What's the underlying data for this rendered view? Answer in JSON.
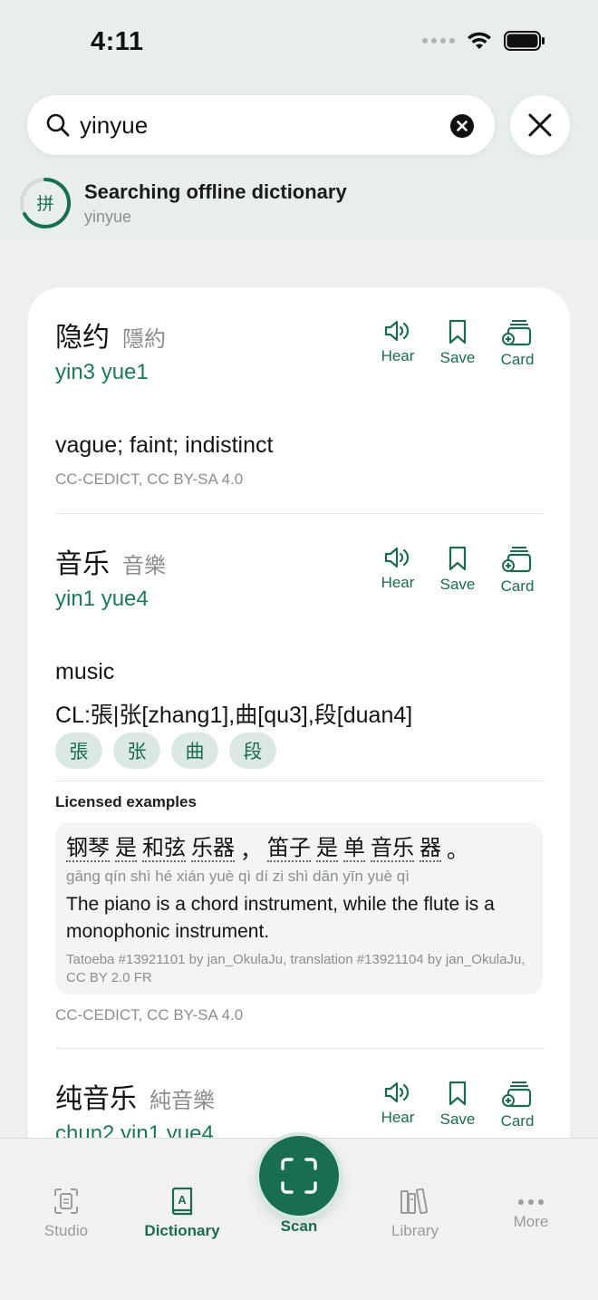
{
  "status_bar": {
    "time": "4:11"
  },
  "search": {
    "value": "yinyue"
  },
  "search_status": {
    "badge": "拼",
    "title": "Searching offline dictionary",
    "query": "yinyue"
  },
  "actions": {
    "hear": "Hear",
    "save": "Save",
    "card": "Card"
  },
  "entries": [
    {
      "simplified": "隐约",
      "traditional": "隱約",
      "pinyin": "yin3 yue1",
      "definitions": [
        "vague; faint; indistinct"
      ],
      "source": "CC-CEDICT, CC BY-SA 4.0"
    },
    {
      "simplified": "音乐",
      "traditional": "音樂",
      "pinyin": "yin1 yue4",
      "definitions": [
        "music",
        "CL:張|张[zhang1],曲[qu3],段[duan4]"
      ],
      "chips": [
        "張",
        "张",
        "曲",
        "段"
      ],
      "examples_heading": "Licensed examples",
      "example": {
        "words": [
          "钢琴",
          "是",
          "和弦",
          "乐器",
          "，",
          "笛子",
          "是",
          "单",
          "音乐",
          "器",
          "。"
        ],
        "pinyin": "gāng qín shì hé xián yuè qì dí zi shì dān yīn yuè qì",
        "translation": "The piano is a chord instrument, while the flute is a monophonic instrument.",
        "credit": "Tatoeba #13921101 by jan_OkulaJu, translation #13921104 by jan_OkulaJu, CC BY 2.0 FR"
      },
      "source": "CC-CEDICT, CC BY-SA 4.0"
    },
    {
      "simplified": "纯音乐",
      "traditional": "純音樂",
      "pinyin": "chun2 yin1 yue4"
    }
  ],
  "tabs": [
    {
      "label": "Studio",
      "icon": "studio-icon"
    },
    {
      "label": "Dictionary",
      "icon": "dictionary-icon",
      "active": true
    },
    {
      "label": "Scan",
      "icon": "scan-icon"
    },
    {
      "label": "Library",
      "icon": "library-icon"
    },
    {
      "label": "More",
      "icon": "more-icon"
    }
  ],
  "colors": {
    "accent": "#1d6b4e",
    "pinyin": "#1b7a54",
    "chip_bg": "#dbe8e3"
  }
}
